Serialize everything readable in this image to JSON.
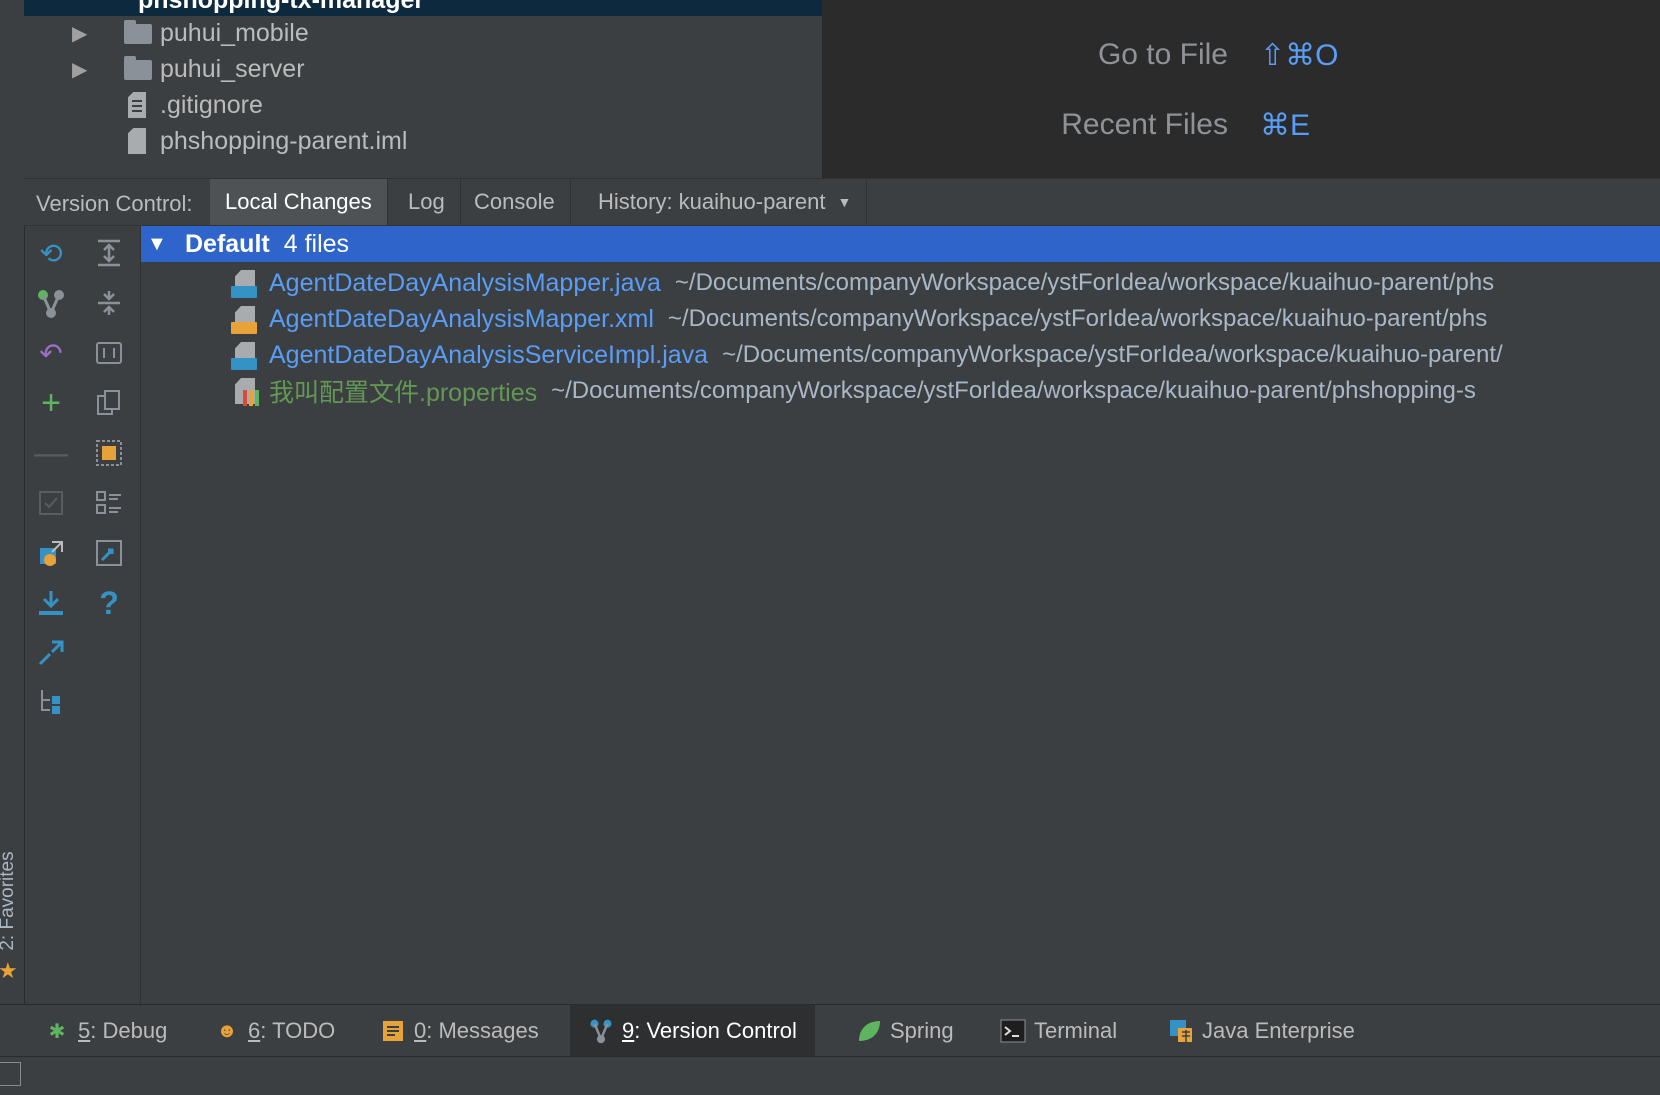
{
  "project_tree": {
    "top_row": "phshopping-tx-manager",
    "items": [
      {
        "label": "puhui_mobile",
        "type": "folder",
        "expandable": true
      },
      {
        "label": "puhui_server",
        "type": "folder",
        "expandable": true
      },
      {
        "label": ".gitignore",
        "type": "file",
        "expandable": false
      },
      {
        "label": "phshopping-parent.iml",
        "type": "file",
        "expandable": false
      }
    ]
  },
  "editor_hints": [
    {
      "label": "Go to File",
      "shortcut": "⇧⌘O"
    },
    {
      "label": "Recent Files",
      "shortcut": "⌘E"
    }
  ],
  "version_control": {
    "title": "Version Control:",
    "tabs": [
      {
        "label": "Local Changes",
        "active": true
      },
      {
        "label": "Log",
        "active": false
      },
      {
        "label": "Console",
        "active": false
      },
      {
        "label": "History: kuaihuo-parent",
        "active": false,
        "dropdown": true
      }
    ],
    "changelist": {
      "name": "Default",
      "count": "4 files"
    },
    "files": [
      {
        "name": "AgentDateDayAnalysisMapper.java",
        "path": "~/Documents/companyWorkspace/ystForIdea/workspace/kuaihuo-parent/phs",
        "status": "modified",
        "icon": "java-file-icon"
      },
      {
        "name": "AgentDateDayAnalysisMapper.xml",
        "path": "~/Documents/companyWorkspace/ystForIdea/workspace/kuaihuo-parent/phs",
        "status": "modified",
        "icon": "xml-file-icon"
      },
      {
        "name": "AgentDateDayAnalysisServiceImpl.java",
        "path": "~/Documents/companyWorkspace/ystForIdea/workspace/kuaihuo-parent/",
        "status": "modified",
        "icon": "java-file-icon"
      },
      {
        "name": "我叫配置文件.properties",
        "path": "~/Documents/companyWorkspace/ystForIdea/workspace/kuaihuo-parent/phshopping-s",
        "status": "new",
        "icon": "properties-file-icon"
      }
    ]
  },
  "left_stripe": {
    "favorites": "2: Favorites"
  },
  "bottom_tabs": [
    {
      "num": "5",
      "label": ": Debug",
      "icon": "debug-icon",
      "active": false
    },
    {
      "num": "6",
      "label": ": TODO",
      "icon": "todo-icon",
      "active": false
    },
    {
      "num": "0",
      "label": ": Messages",
      "icon": "messages-icon",
      "active": false
    },
    {
      "num": "9",
      "label": ": Version Control",
      "icon": "vcs-icon",
      "active": true
    },
    {
      "num": "",
      "label": "Spring",
      "icon": "spring-icon",
      "active": false
    },
    {
      "num": "",
      "label": "Terminal",
      "icon": "terminal-icon",
      "active": false
    },
    {
      "num": "",
      "label": "Java Enterprise",
      "icon": "java-enterprise-icon",
      "active": false
    }
  ],
  "colors": {
    "accent_blue": "#589df6",
    "selection": "#2f65ca",
    "new_file_green": "#629755"
  }
}
